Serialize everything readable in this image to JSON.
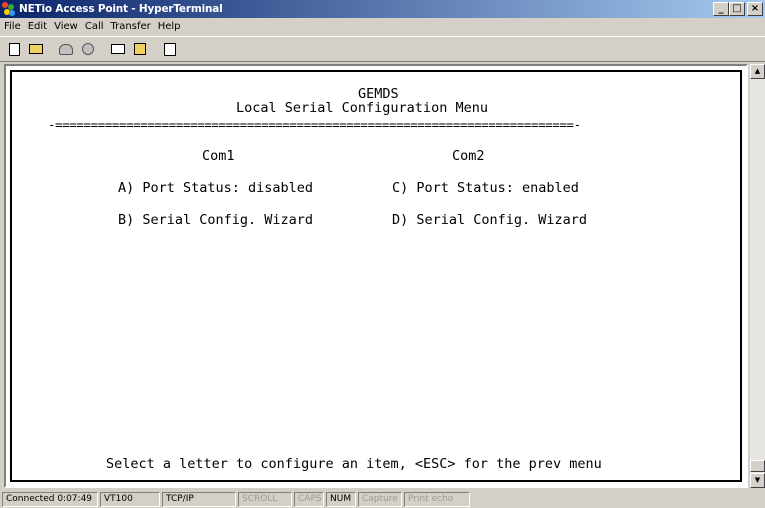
{
  "window": {
    "title": "NETio Access Point - HyperTerminal",
    "minimize": "_",
    "maximize": "□",
    "close": "×"
  },
  "menu": [
    "File",
    "Edit",
    "View",
    "Call",
    "Transfer",
    "Help"
  ],
  "toolbar": {
    "icons": [
      "new-connection-icon",
      "open-icon",
      "call-icon",
      "disconnect-icon",
      "send-icon",
      "receive-icon",
      "properties-icon"
    ]
  },
  "terminal": {
    "line_vendor": "GEMDS",
    "line_title": "Local Serial Configuration Menu",
    "line_rule": "-=========================================================================-",
    "col1_header": "Com1",
    "col2_header": "Com2",
    "item_a": "A) Port Status: disabled",
    "item_c": "C) Port Status: enabled",
    "item_b": "B) Serial Config. Wizard",
    "item_d": "D) Serial Config. Wizard",
    "prompt": "Select a letter to configure an item, <ESC> for the prev menu"
  },
  "status": {
    "connected": "Connected 0:07:49",
    "emulation": "VT100",
    "protocol": "TCP/IP",
    "scroll": "SCROLL",
    "caps": "CAPS",
    "num": "NUM",
    "capture": "Capture",
    "print_echo": "Print echo"
  }
}
